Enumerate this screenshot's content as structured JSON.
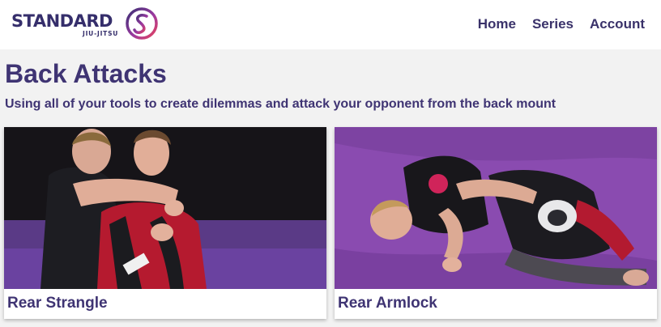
{
  "header": {
    "logo": {
      "wordmark": "STANDARD",
      "tagline": "JIU-JITSU"
    },
    "nav": [
      {
        "label": "Home"
      },
      {
        "label": "Series"
      },
      {
        "label": "Account"
      }
    ]
  },
  "page": {
    "title": "Back Attacks",
    "subtitle": "Using all of your tools to create dilemmas and attack your opponent from the back mount"
  },
  "cards": [
    {
      "title": "Rear Strangle",
      "thumbnail": "rear-strangle-photo"
    },
    {
      "title": "Rear Armlock",
      "thumbnail": "rear-armlock-photo"
    }
  ],
  "colors": {
    "brand": "#3f3473",
    "page_background": "#f2f2f2",
    "mat_purple": "#8a4bb0",
    "accent_red": "#c01c35"
  }
}
